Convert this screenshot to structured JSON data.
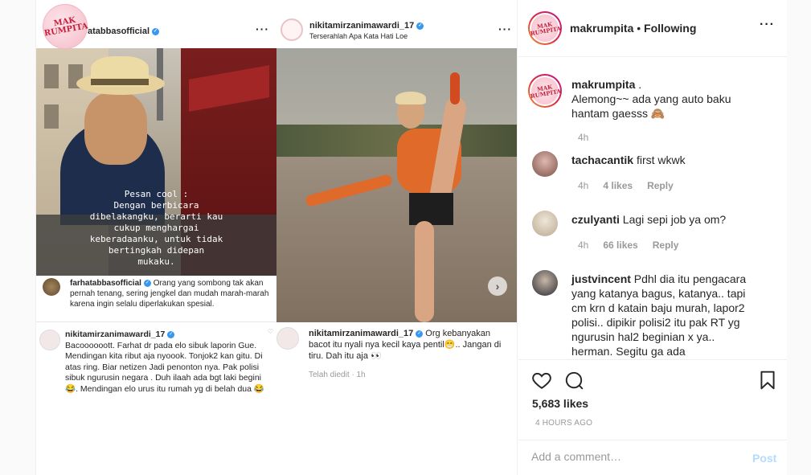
{
  "media": {
    "left": {
      "header_username": "atabbasofficial",
      "logo_text": "MAK RUMPITA",
      "overlay_text": "Pesan cool :\nDengan berbicara\ndibelakangku, berarti kau\ncukup menghargai\nkeberadaanku, untuk tidak\nbertingkah didepan\nmukaku.",
      "comments": [
        {
          "username": "farhatabbasofficial",
          "text": "Orang yang sombong tak akan pernah tenang, sering jengkel dan mudah marah-marah karena ingin selalu diperlakukan spesial."
        },
        {
          "username": "nikitamirzanimawardi_17",
          "text": "Bacoooooott. Farhat dr pada elo sibuk laporin Gue. Mendingan kita ribut aja nyoook. Tonjok2 kan gitu. Di atas ring. Biar netizen Jadi penonton nya. Pak polisi sibuk ngurusin negara . Duh ilaah ada bgt laki begini 😂. Mendingan elo urus itu rumah yg di belah dua 😂"
        }
      ]
    },
    "right": {
      "header_username": "nikitamirzanimawardi_17",
      "header_subtitle": "Terserahlah Apa Kata Hati Loe",
      "comment": {
        "username": "nikitamirzanimawardi_17",
        "text": "Org kebanyakan bacot itu nyali nya kecil kaya pentil😁.. Jangan di tiru. Dah itu aja 👀"
      },
      "comment_meta": "Telah diedit · 1h"
    }
  },
  "sidebar": {
    "header": {
      "username": "makrumpita",
      "separator": " • ",
      "follow_state": "Following"
    },
    "caption": {
      "username": "makrumpita",
      "dot": " .",
      "text": "Alemong~~ ada yang auto baku hantam gaesss 🙈",
      "time": "4h"
    },
    "comments": [
      {
        "username": "tachacantik",
        "text": "first wkwk",
        "time": "4h",
        "likes": "4 likes",
        "reply": "Reply"
      },
      {
        "username": "czulyanti",
        "text": "Lagi sepi job ya om?",
        "time": "4h",
        "likes": "66 likes",
        "reply": "Reply"
      },
      {
        "username": "justvincent",
        "text": "Pdhl dia itu pengacara yang katanya bagus, katanya.. tapi cm krn d katain baju murah, lapor2 polisi.. dipikir polisi2 itu pak RT yg ngurusin hal2 beginian x ya.. herman. Segitu ga ada",
        "time": "",
        "likes": "",
        "reply": ""
      }
    ],
    "likes": "5,683 likes",
    "timestamp": "4 HOURS AGO",
    "add_comment_placeholder": "Add a comment…",
    "post_label": "Post"
  },
  "colors": {
    "accent": "#3897f0",
    "post_disabled": "#b3dbff",
    "muted": "#999999"
  }
}
